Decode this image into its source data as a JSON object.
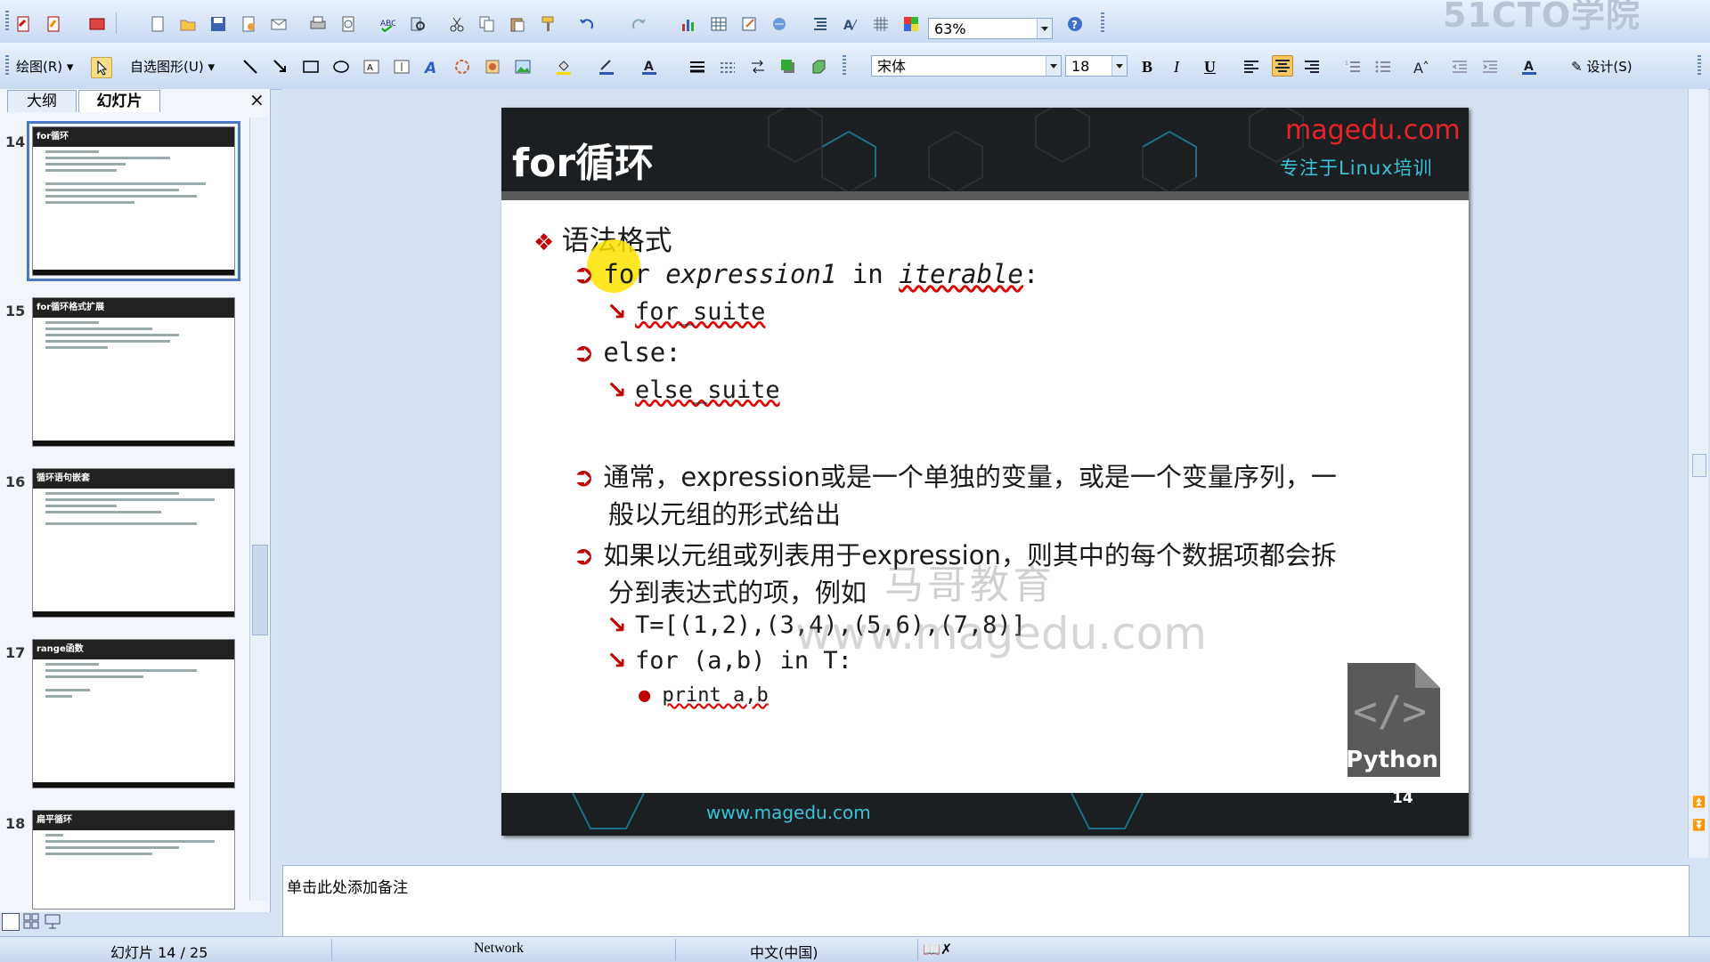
{
  "watermark_top": "51CTO学院",
  "toolbar1": {
    "zoom": "63%",
    "help": "?"
  },
  "toolbar2": {
    "draw_menu": "绘图(R)",
    "autoshape_menu": "自选图形(U)",
    "font_name": "宋体",
    "font_size": "18",
    "bold": "B",
    "italic": "I",
    "underline": "U",
    "design": "设计(S)"
  },
  "left_pane": {
    "tabs": [
      "大纲",
      "幻灯片"
    ],
    "close": "×",
    "slides": [
      {
        "num": "14",
        "title": "for循环",
        "selected": true
      },
      {
        "num": "15",
        "title": "for循环格式扩展",
        "selected": false
      },
      {
        "num": "16",
        "title": "循环语句嵌套",
        "selected": false
      },
      {
        "num": "17",
        "title": "range函数",
        "selected": false
      },
      {
        "num": "18",
        "title": "扁平循环",
        "selected": false
      }
    ]
  },
  "slide": {
    "title": "for循环",
    "brand": "magedu.com",
    "brand_sub": "专注于Linux培训",
    "heading": "语法格式",
    "line1": {
      "kw_for": "for",
      "expr": "expression1",
      "kw_in": "in",
      "iter": "iterable",
      "colon": ":"
    },
    "line1_sub": "for_suite",
    "line2": "else:",
    "line2_sub": "else_suite",
    "para1_a": "通常，expression或是一个单独的变量，或是一个变量序列，一",
    "para1_b": "般以元组的形式给出",
    "para2_a": "如果以元组或列表用于expression，则其中的每个数据项都会拆",
    "para2_b": "分到表达式的项，例如",
    "ex1": "T=[(1,2),(3,4),(5,6),(7,8)]",
    "ex2": "for (a,b) in T:",
    "ex3": "print a,b",
    "watermark1": "马哥教育",
    "watermark2": "www.magedu.com",
    "python_label": "Python",
    "footer_url": "www.magedu.com",
    "page_num": "14"
  },
  "notes_placeholder": "单击此处添加备注",
  "status": {
    "slide_pos": "幻灯片 14 / 25",
    "design": "Network",
    "language": "中文(中国)"
  },
  "colors": {
    "bullet_red": "#c00000",
    "brand_red": "#e8242a",
    "brand_cyan": "#39c3d8",
    "slide_dark": "#1c1f22"
  }
}
